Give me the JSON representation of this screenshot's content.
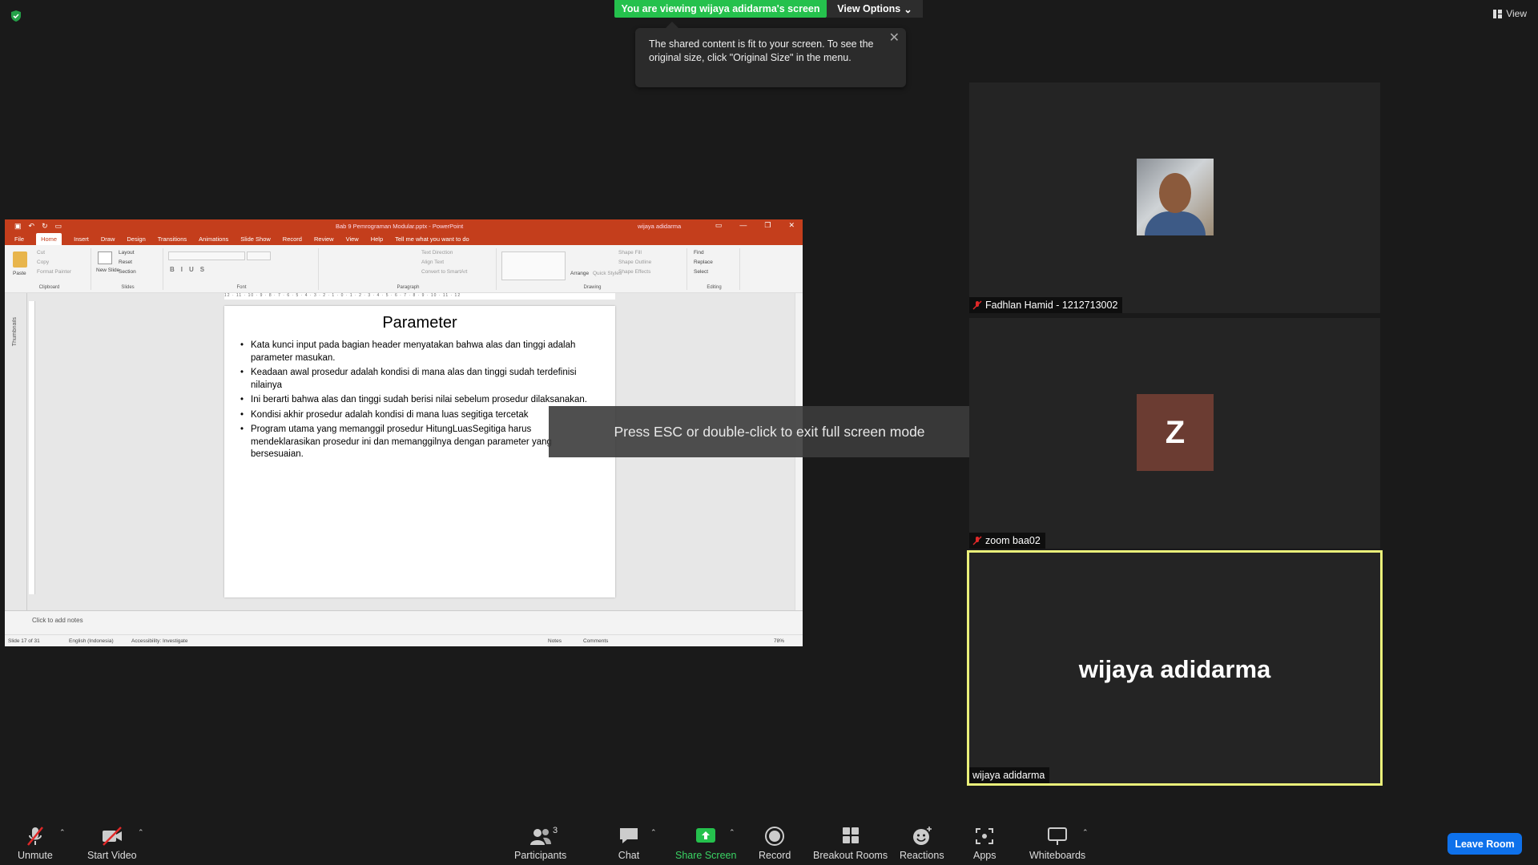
{
  "meeting": {
    "viewing_banner": "You are viewing wijaya adidarma's screen",
    "view_options": "View Options",
    "view_label": "View",
    "tooltip_text": "The shared content is fit to your screen. To see the original size, click \"Original Size\" in the menu.",
    "esc_message": "Press ESC or double-click to exit full screen mode"
  },
  "powerpoint": {
    "doc_title": "Bab 9 Pemrograman Modular.pptx - PowerPoint",
    "user": "wijaya adidarma",
    "tabs": [
      "File",
      "Home",
      "Insert",
      "Draw",
      "Design",
      "Transitions",
      "Animations",
      "Slide Show",
      "Record",
      "Review",
      "View",
      "Help"
    ],
    "tell_me": "Tell me what you want to do",
    "ribbon": {
      "clipboard": {
        "label": "Clipboard",
        "paste": "Paste",
        "cut": "Cut",
        "copy": "Copy",
        "format_painter": "Format Painter"
      },
      "slides": {
        "label": "Slides",
        "new_slide": "New Slide",
        "layout": "Layout",
        "reset": "Reset",
        "section": "Section"
      },
      "font": {
        "label": "Font"
      },
      "paragraph": {
        "label": "Paragraph",
        "text_direction": "Text Direction",
        "align_text": "Align Text",
        "convert": "Convert to SmartArt"
      },
      "drawing": {
        "label": "Drawing",
        "arrange": "Arrange",
        "quick_styles": "Quick Styles",
        "shape_fill": "Shape Fill",
        "shape_outline": "Shape Outline",
        "shape_effects": "Shape Effects"
      },
      "editing": {
        "label": "Editing",
        "find": "Find",
        "replace": "Replace",
        "select": "Select"
      }
    },
    "thumbnails_label": "Thumbnails",
    "ruler_text": "12 · 11 · 10 · 9 · 8 · 7 · 6 · 5 · 4 · 3 · 2 · 1 · 0 · 1 · 2 · 3 · 4 · 5 · 6 · 7 · 8 · 9 · 10 · 11 · 12",
    "slide": {
      "title": "Parameter",
      "bullets": [
        "Kata kunci input pada bagian header menyatakan bahwa alas dan tinggi adalah parameter masukan.",
        "Keadaan awal prosedur adalah kondisi di mana alas dan tinggi sudah terdefinisi nilainya",
        "Ini berarti bahwa alas dan tinggi sudah berisi nilai sebelum prosedur dilaksanakan.",
        "Kondisi akhir prosedur adalah kondisi di mana luas segitiga tercetak",
        "Program utama yang memanggil prosedur HitungLuasSegitiga harus mendeklarasikan prosedur ini dan memanggilnya dengan parameter yang bersesuaian."
      ]
    },
    "notes_placeholder": "Click to add notes",
    "status": {
      "slide": "Slide 17 of 31",
      "language": "English (Indonesia)",
      "accessibility": "Accessibility: Investigate",
      "notes": "Notes",
      "comments": "Comments",
      "zoom": "78%"
    }
  },
  "participants": [
    {
      "name": "Fadhlan Hamid - 1212713002",
      "muted": true
    },
    {
      "name": "zoom baa02",
      "muted": true,
      "initial": "Z"
    },
    {
      "name": "wijaya adidarma",
      "display_name": "wijaya adidarma",
      "muted": false
    }
  ],
  "toolbar": {
    "unmute": "Unmute",
    "start_video": "Start Video",
    "participants": "Participants",
    "participants_count": "3",
    "chat": "Chat",
    "share_screen": "Share Screen",
    "record": "Record",
    "breakout_rooms": "Breakout Rooms",
    "reactions": "Reactions",
    "apps": "Apps",
    "whiteboards": "Whiteboards",
    "leave": "Leave Room"
  },
  "colors": {
    "share_green": "#25c14d",
    "ppt_red": "#c43e1c",
    "active_speaker": "#eaf07a",
    "leave_blue": "#0e71eb",
    "muted_red": "#e02828"
  }
}
